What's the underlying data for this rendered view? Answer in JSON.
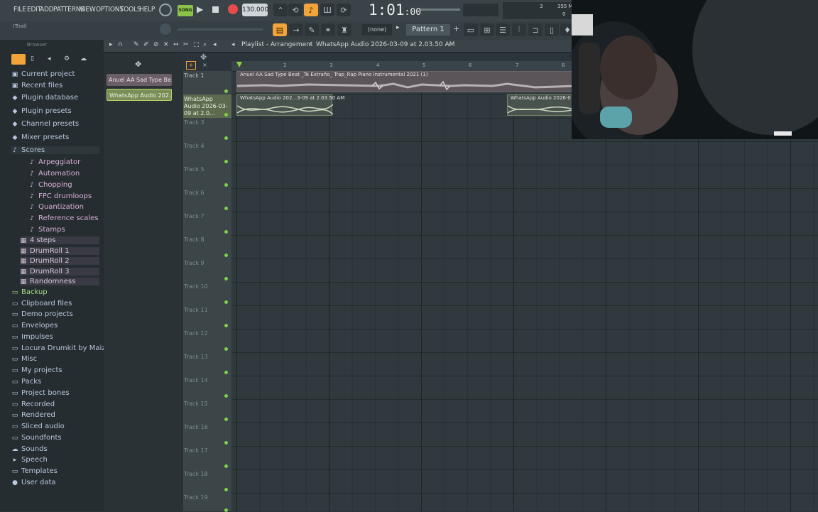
{
  "menu": [
    "FILE",
    "EDIT",
    "ADD",
    "PATTERNS",
    "VIEW",
    "OPTIONS",
    "TOOLS",
    "HELP"
  ],
  "transport": {
    "song_mode": "SONG",
    "tempo": "130.000",
    "time": "1:01",
    "time_ticks": ":00",
    "cpu_top": "3",
    "mem": "355 M",
    "poly": "0"
  },
  "hint": "(Trial)",
  "toolbar": {
    "channel_select": "(none)",
    "pattern": "Pattern 1"
  },
  "browser": {
    "title": "Browser",
    "items": [
      {
        "label": "Current project",
        "icon": "project-icon"
      },
      {
        "label": "Recent files",
        "icon": "recent-icon"
      },
      {
        "label": "Plugin database",
        "icon": "plugin-icon"
      },
      {
        "label": "Plugin presets",
        "icon": "preset-icon"
      },
      {
        "label": "Channel presets",
        "icon": "preset-icon"
      },
      {
        "label": "Mixer presets",
        "icon": "preset-icon"
      },
      {
        "label": "Scores",
        "icon": "note-icon"
      }
    ],
    "scores": [
      "Arpeggiator",
      "Automation",
      "Chopping",
      "FPC drumloops",
      "Quantization",
      "Reference scales",
      "Stamps"
    ],
    "files": [
      "4 steps",
      "DrumRoll 1",
      "DrumRoll 2",
      "DrumRoll 3",
      "Randomness"
    ],
    "folders": [
      "Backup",
      "Clipboard files",
      "Demo projects",
      "Envelopes",
      "Impulses",
      "Locura Drumkit by Maizzeno",
      "Misc",
      "My projects",
      "Packs",
      "Project bones",
      "Recorded",
      "Rendered",
      "Sliced audio",
      "Soundfonts",
      "Sounds",
      "Speech",
      "Templates",
      "User data"
    ]
  },
  "channels": [
    "Anuel AA Sad Type Be...",
    "WhatsApp Audio 202..."
  ],
  "playlist": {
    "breadcrumb": "Playlist - Arrangement",
    "current": "WhatsApp Audio 2026-03-09 at 2.03.50 AM",
    "ruler": [
      "2",
      "3",
      "4",
      "5",
      "6",
      "7",
      "8"
    ],
    "tracks": [
      {
        "label": "Track 1"
      },
      {
        "label": "WhatsApp Audio 2026-03-09 at 2.0..."
      },
      {
        "label": "Track 3"
      },
      {
        "label": "Track 4"
      },
      {
        "label": "Track 5"
      },
      {
        "label": "Track 6"
      },
      {
        "label": "Track 7"
      },
      {
        "label": "Track 8"
      },
      {
        "label": "Track 9"
      },
      {
        "label": "Track 10"
      },
      {
        "label": "Track 11"
      },
      {
        "label": "Track 12"
      },
      {
        "label": "Track 13"
      },
      {
        "label": "Track 14"
      },
      {
        "label": "Track 15"
      },
      {
        "label": "Track 16"
      },
      {
        "label": "Track 17"
      },
      {
        "label": "Track 18"
      },
      {
        "label": "Track 19"
      }
    ],
    "clip_beat": "Anuel AA Sad Type Beat _Te Extraño_ Trap_Rap Piano Instrumental 2021 (1)",
    "clip_audio_1": "WhatsApp Audio 202...3-09 at 2.03.50 AM",
    "clip_audio_2": "WhatsApp Audio 2026-0"
  },
  "colors": {
    "accent": "#f2a33a",
    "track_dot": "#7fd14b",
    "audio_clip": "#48534e",
    "beat_clip": "#5b5458"
  }
}
